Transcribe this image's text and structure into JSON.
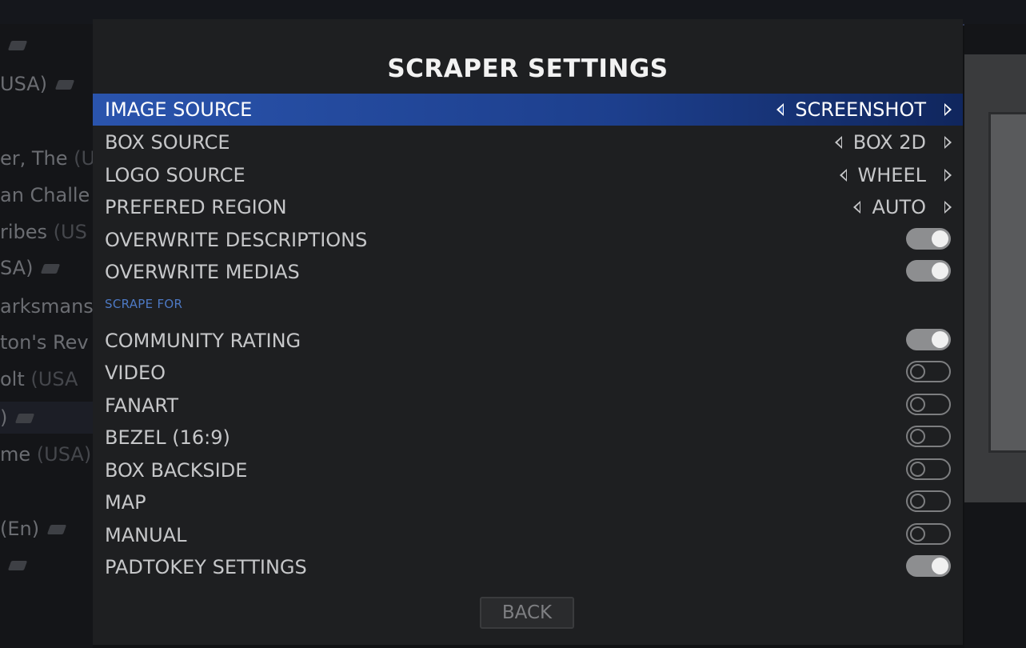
{
  "background": {
    "list_items": [
      {
        "text": "",
        "suffix": "",
        "gun": true
      },
      {
        "text": "USA)",
        "suffix": "",
        "gun": true
      },
      {
        "text": "",
        "suffix": "",
        "gun": false
      },
      {
        "text": "er, The",
        "suffix": " (U",
        "gun": false
      },
      {
        "text": "an Challe",
        "suffix": "",
        "gun": false
      },
      {
        "text": "ribes",
        "suffix": " (US",
        "gun": false
      },
      {
        "text": "SA)",
        "suffix": "",
        "gun": true
      },
      {
        "text": "arksmans",
        "suffix": "",
        "gun": false
      },
      {
        "text": "ton's Rev",
        "suffix": "",
        "gun": false
      },
      {
        "text": "olt",
        "suffix": " (USA",
        "gun": false
      },
      {
        "text": ")",
        "suffix": "",
        "gun": true
      },
      {
        "text": "me",
        "suffix": " (USA)",
        "gun": false
      },
      {
        "text": "",
        "suffix": "",
        "gun": false
      },
      {
        "text": "(En)",
        "suffix": "",
        "gun": true
      },
      {
        "text": "",
        "suffix": "",
        "gun": true
      }
    ]
  },
  "dialog": {
    "title": "SCRAPER SETTINGS",
    "option_rows": [
      {
        "label": "IMAGE SOURCE",
        "value": "SCREENSHOT",
        "selected": true
      },
      {
        "label": "BOX SOURCE",
        "value": "BOX 2D",
        "selected": false
      },
      {
        "label": "LOGO SOURCE",
        "value": "WHEEL",
        "selected": false
      },
      {
        "label": "PREFERED REGION",
        "value": "AUTO",
        "selected": false
      }
    ],
    "toggle_rows": [
      {
        "label": "OVERWRITE DESCRIPTIONS",
        "on": true
      },
      {
        "label": "OVERWRITE MEDIAS",
        "on": true
      }
    ],
    "section_label": "SCRAPE FOR",
    "scrape_rows": [
      {
        "label": "COMMUNITY RATING",
        "on": true
      },
      {
        "label": "VIDEO",
        "on": false
      },
      {
        "label": "FANART",
        "on": false
      },
      {
        "label": "BEZEL (16:9)",
        "on": false
      },
      {
        "label": "BOX BACKSIDE",
        "on": false
      },
      {
        "label": "MAP",
        "on": false
      },
      {
        "label": "MANUAL",
        "on": false
      },
      {
        "label": "PADTOKEY SETTINGS",
        "on": true
      }
    ],
    "back_label": "BACK"
  },
  "colors": {
    "selection_blue": "#2a54ad",
    "section_blue": "#4d79c4",
    "toggle_on": "#8d8e90"
  }
}
